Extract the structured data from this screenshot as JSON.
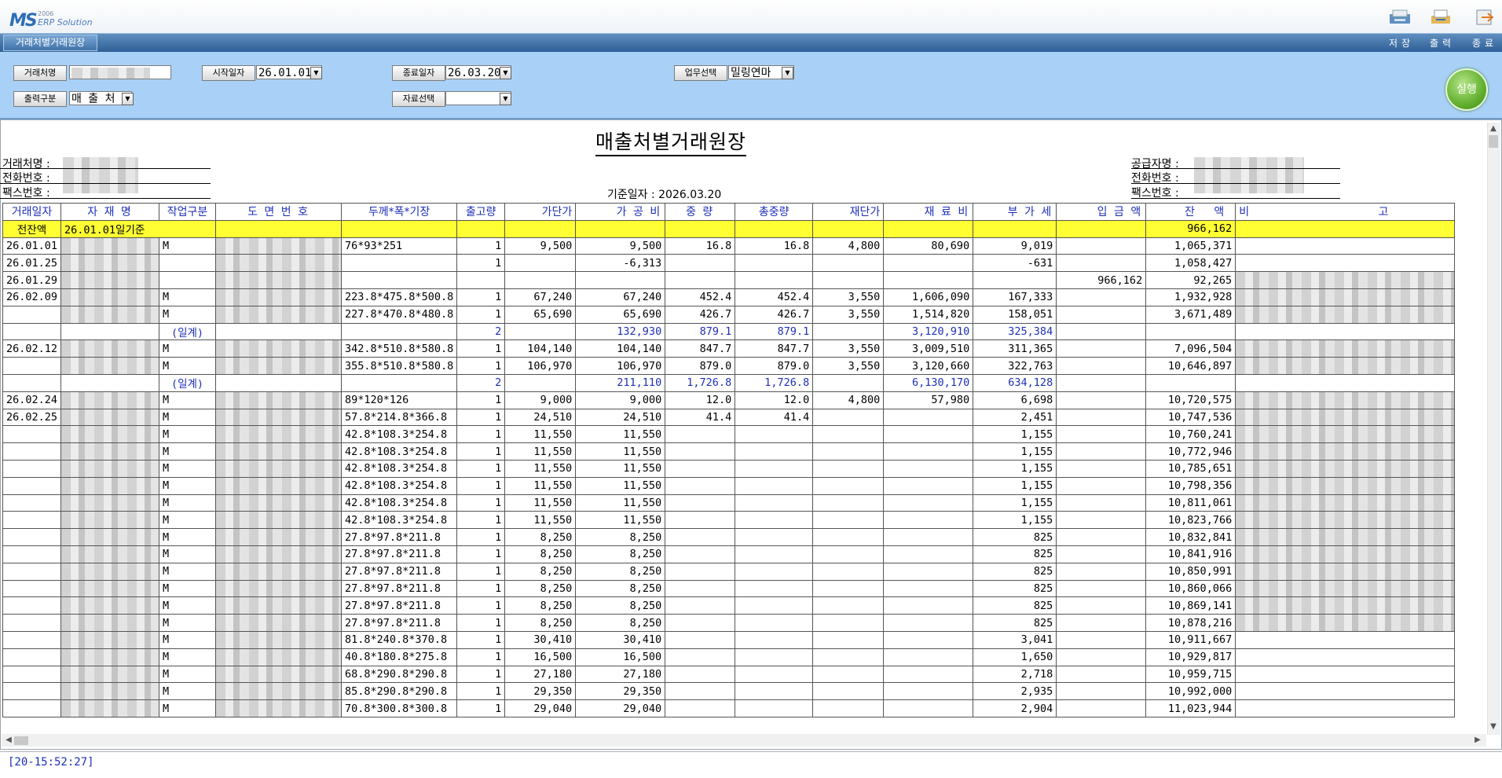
{
  "app": {
    "logo_ms": "MS",
    "logo_year": "2006",
    "logo_text": "ERP Solution",
    "tab_title": "거래처별거래원장",
    "toolbar": {
      "save": "저장",
      "print": "출력",
      "exit": "종료"
    }
  },
  "filters": {
    "client_label": "거래처명",
    "client_value": "",
    "output_type_label": "출력구분",
    "output_type_value": "매 출 처",
    "start_date_label": "시작일자",
    "start_date_value": "26.01.01",
    "end_date_label": "종료일자",
    "end_date_value": "26.03.20",
    "data_select_label": "자료선택",
    "data_select_value": "",
    "business_label": "업무선택",
    "business_value": "밀링연마",
    "run_label": "실행"
  },
  "report": {
    "title": "매출처별거래원장",
    "left_labels": [
      "거래처명 :",
      "전화번호 :",
      "팩스번호 :"
    ],
    "right_labels": [
      "공급자명 :",
      "전화번호 :",
      "팩스번호 :"
    ],
    "base_date": "기준일자 : 2026.03.20"
  },
  "table": {
    "headers": [
      "거래일자",
      "자 재 명",
      "작업구분",
      "도 면 번 호",
      "두께*폭*기장",
      "출고량",
      "가단가",
      "가 공 비",
      "중 량",
      "총중량",
      "재단가",
      "재 료 비",
      "부 가 세",
      "입 금 액",
      "잔 액",
      "비 고"
    ],
    "opening_row": {
      "label": "전잔액",
      "desc": "26.01.01일기준",
      "balance": "966,162"
    },
    "rows": [
      {
        "date": "26.01.01",
        "work": "M",
        "dim": "76*93*251",
        "qty": "1",
        "unit": "9,500",
        "proc": "9,500",
        "wt": "16.8",
        "twt": "16.8",
        "mu": "4,800",
        "mat": "80,690",
        "vat": "9,019",
        "dep": "",
        "bal": "1,065,371",
        "blur": [
          true,
          true,
          false
        ]
      },
      {
        "date": "26.01.25",
        "work": "",
        "dim": "",
        "qty": "1",
        "unit": "",
        "proc": "-6,313",
        "wt": "",
        "twt": "",
        "mu": "",
        "mat": "",
        "vat": "-631",
        "dep": "",
        "bal": "1,058,427",
        "blur": [
          true,
          true,
          false
        ]
      },
      {
        "date": "26.01.29",
        "work": "",
        "dim": "",
        "qty": "",
        "unit": "",
        "proc": "",
        "wt": "",
        "twt": "",
        "mu": "",
        "mat": "",
        "vat": "",
        "dep": "966,162",
        "bal": "92,265",
        "blur": [
          true,
          true,
          true
        ]
      },
      {
        "date": "26.02.09",
        "work": "M",
        "dim": "223.8*475.8*500.8",
        "qty": "1",
        "unit": "67,240",
        "proc": "67,240",
        "wt": "452.4",
        "twt": "452.4",
        "mu": "3,550",
        "mat": "1,606,090",
        "vat": "167,333",
        "dep": "",
        "bal": "1,932,928",
        "blur": [
          true,
          true,
          true
        ]
      },
      {
        "date": "",
        "work": "M",
        "dim": "227.8*470.8*480.8",
        "qty": "1",
        "unit": "65,690",
        "proc": "65,690",
        "wt": "426.7",
        "twt": "426.7",
        "mu": "3,550",
        "mat": "1,514,820",
        "vat": "158,051",
        "dep": "",
        "bal": "3,671,489",
        "blur": [
          true,
          true,
          true
        ]
      },
      {
        "sub": true,
        "work": "(일계)",
        "qty": "2",
        "proc": "132,930",
        "wt": "879.1",
        "twt": "879.1",
        "mat": "3,120,910",
        "vat": "325,384"
      },
      {
        "date": "26.02.12",
        "work": "M",
        "dim": "342.8*510.8*580.8",
        "qty": "1",
        "unit": "104,140",
        "proc": "104,140",
        "wt": "847.7",
        "twt": "847.7",
        "mu": "3,550",
        "mat": "3,009,510",
        "vat": "311,365",
        "dep": "",
        "bal": "7,096,504",
        "blur": [
          true,
          true,
          true
        ]
      },
      {
        "date": "",
        "work": "M",
        "dim": "355.8*510.8*580.8",
        "qty": "1",
        "unit": "106,970",
        "proc": "106,970",
        "wt": "879.0",
        "twt": "879.0",
        "mu": "3,550",
        "mat": "3,120,660",
        "vat": "322,763",
        "dep": "",
        "bal": "10,646,897",
        "blur": [
          true,
          true,
          true
        ]
      },
      {
        "sub": true,
        "work": "(일계)",
        "qty": "2",
        "proc": "211,110",
        "wt": "1,726.8",
        "twt": "1,726.8",
        "mat": "6,130,170",
        "vat": "634,128"
      },
      {
        "date": "26.02.24",
        "work": "M",
        "dim": "89*120*126",
        "qty": "1",
        "unit": "9,000",
        "proc": "9,000",
        "wt": "12.0",
        "twt": "12.0",
        "mu": "4,800",
        "mat": "57,980",
        "vat": "6,698",
        "dep": "",
        "bal": "10,720,575",
        "blur": [
          true,
          true,
          true
        ]
      },
      {
        "date": "26.02.25",
        "work": "M",
        "dim": "57.8*214.8*366.8",
        "qty": "1",
        "unit": "24,510",
        "proc": "24,510",
        "wt": "41.4",
        "twt": "41.4",
        "mu": "",
        "mat": "",
        "vat": "2,451",
        "dep": "",
        "bal": "10,747,536",
        "blur": [
          true,
          true,
          true
        ]
      },
      {
        "date": "",
        "work": "M",
        "dim": "42.8*108.3*254.8",
        "qty": "1",
        "unit": "11,550",
        "proc": "11,550",
        "wt": "",
        "twt": "",
        "mu": "",
        "mat": "",
        "vat": "1,155",
        "dep": "",
        "bal": "10,760,241",
        "blur": [
          true,
          true,
          true
        ]
      },
      {
        "date": "",
        "work": "M",
        "dim": "42.8*108.3*254.8",
        "qty": "1",
        "unit": "11,550",
        "proc": "11,550",
        "wt": "",
        "twt": "",
        "mu": "",
        "mat": "",
        "vat": "1,155",
        "dep": "",
        "bal": "10,772,946",
        "blur": [
          true,
          true,
          true
        ]
      },
      {
        "date": "",
        "work": "M",
        "dim": "42.8*108.3*254.8",
        "qty": "1",
        "unit": "11,550",
        "proc": "11,550",
        "wt": "",
        "twt": "",
        "mu": "",
        "mat": "",
        "vat": "1,155",
        "dep": "",
        "bal": "10,785,651",
        "blur": [
          true,
          true,
          true
        ]
      },
      {
        "date": "",
        "work": "M",
        "dim": "42.8*108.3*254.8",
        "qty": "1",
        "unit": "11,550",
        "proc": "11,550",
        "wt": "",
        "twt": "",
        "mu": "",
        "mat": "",
        "vat": "1,155",
        "dep": "",
        "bal": "10,798,356",
        "blur": [
          true,
          true,
          true
        ]
      },
      {
        "date": "",
        "work": "M",
        "dim": "42.8*108.3*254.8",
        "qty": "1",
        "unit": "11,550",
        "proc": "11,550",
        "wt": "",
        "twt": "",
        "mu": "",
        "mat": "",
        "vat": "1,155",
        "dep": "",
        "bal": "10,811,061",
        "blur": [
          true,
          true,
          true
        ]
      },
      {
        "date": "",
        "work": "M",
        "dim": "42.8*108.3*254.8",
        "qty": "1",
        "unit": "11,550",
        "proc": "11,550",
        "wt": "",
        "twt": "",
        "mu": "",
        "mat": "",
        "vat": "1,155",
        "dep": "",
        "bal": "10,823,766",
        "blur": [
          true,
          true,
          true
        ]
      },
      {
        "date": "",
        "work": "M",
        "dim": "27.8*97.8*211.8",
        "qty": "1",
        "unit": "8,250",
        "proc": "8,250",
        "wt": "",
        "twt": "",
        "mu": "",
        "mat": "",
        "vat": "825",
        "dep": "",
        "bal": "10,832,841",
        "blur": [
          true,
          true,
          true
        ]
      },
      {
        "date": "",
        "work": "M",
        "dim": "27.8*97.8*211.8",
        "qty": "1",
        "unit": "8,250",
        "proc": "8,250",
        "wt": "",
        "twt": "",
        "mu": "",
        "mat": "",
        "vat": "825",
        "dep": "",
        "bal": "10,841,916",
        "blur": [
          true,
          true,
          true
        ]
      },
      {
        "date": "",
        "work": "M",
        "dim": "27.8*97.8*211.8",
        "qty": "1",
        "unit": "8,250",
        "proc": "8,250",
        "wt": "",
        "twt": "",
        "mu": "",
        "mat": "",
        "vat": "825",
        "dep": "",
        "bal": "10,850,991",
        "blur": [
          true,
          true,
          true
        ]
      },
      {
        "date": "",
        "work": "M",
        "dim": "27.8*97.8*211.8",
        "qty": "1",
        "unit": "8,250",
        "proc": "8,250",
        "wt": "",
        "twt": "",
        "mu": "",
        "mat": "",
        "vat": "825",
        "dep": "",
        "bal": "10,860,066",
        "blur": [
          true,
          true,
          true
        ]
      },
      {
        "date": "",
        "work": "M",
        "dim": "27.8*97.8*211.8",
        "qty": "1",
        "unit": "8,250",
        "proc": "8,250",
        "wt": "",
        "twt": "",
        "mu": "",
        "mat": "",
        "vat": "825",
        "dep": "",
        "bal": "10,869,141",
        "blur": [
          true,
          true,
          true
        ]
      },
      {
        "date": "",
        "work": "M",
        "dim": "27.8*97.8*211.8",
        "qty": "1",
        "unit": "8,250",
        "proc": "8,250",
        "wt": "",
        "twt": "",
        "mu": "",
        "mat": "",
        "vat": "825",
        "dep": "",
        "bal": "10,878,216",
        "blur": [
          true,
          true,
          true
        ]
      },
      {
        "date": "",
        "work": "M",
        "dim": "81.8*240.8*370.8",
        "qty": "1",
        "unit": "30,410",
        "proc": "30,410",
        "wt": "",
        "twt": "",
        "mu": "",
        "mat": "",
        "vat": "3,041",
        "dep": "",
        "bal": "10,911,667",
        "blur": [
          true,
          true,
          false
        ]
      },
      {
        "date": "",
        "work": "M",
        "dim": "40.8*180.8*275.8",
        "qty": "1",
        "unit": "16,500",
        "proc": "16,500",
        "wt": "",
        "twt": "",
        "mu": "",
        "mat": "",
        "vat": "1,650",
        "dep": "",
        "bal": "10,929,817",
        "blur": [
          true,
          true,
          false
        ]
      },
      {
        "date": "",
        "work": "M",
        "dim": "68.8*290.8*290.8",
        "qty": "1",
        "unit": "27,180",
        "proc": "27,180",
        "wt": "",
        "twt": "",
        "mu": "",
        "mat": "",
        "vat": "2,718",
        "dep": "",
        "bal": "10,959,715",
        "blur": [
          true,
          true,
          false
        ]
      },
      {
        "date": "",
        "work": "M",
        "dim": "85.8*290.8*290.8",
        "qty": "1",
        "unit": "29,350",
        "proc": "29,350",
        "wt": "",
        "twt": "",
        "mu": "",
        "mat": "",
        "vat": "2,935",
        "dep": "",
        "bal": "10,992,000",
        "blur": [
          true,
          true,
          false
        ]
      },
      {
        "date": "",
        "work": "M",
        "dim": "70.8*300.8*300.8",
        "qty": "1",
        "unit": "29,040",
        "proc": "29,040",
        "wt": "",
        "twt": "",
        "mu": "",
        "mat": "",
        "vat": "2,904",
        "dep": "",
        "bal": "11,023,944",
        "blur": [
          true,
          true,
          false
        ]
      }
    ]
  },
  "status": {
    "message": "[20-15:52:27]"
  },
  "colors": {
    "panel": "#a9d1f7",
    "header_text": "#1e2fb8",
    "highlight": "#ffff33",
    "run_button": "#62b02e"
  }
}
